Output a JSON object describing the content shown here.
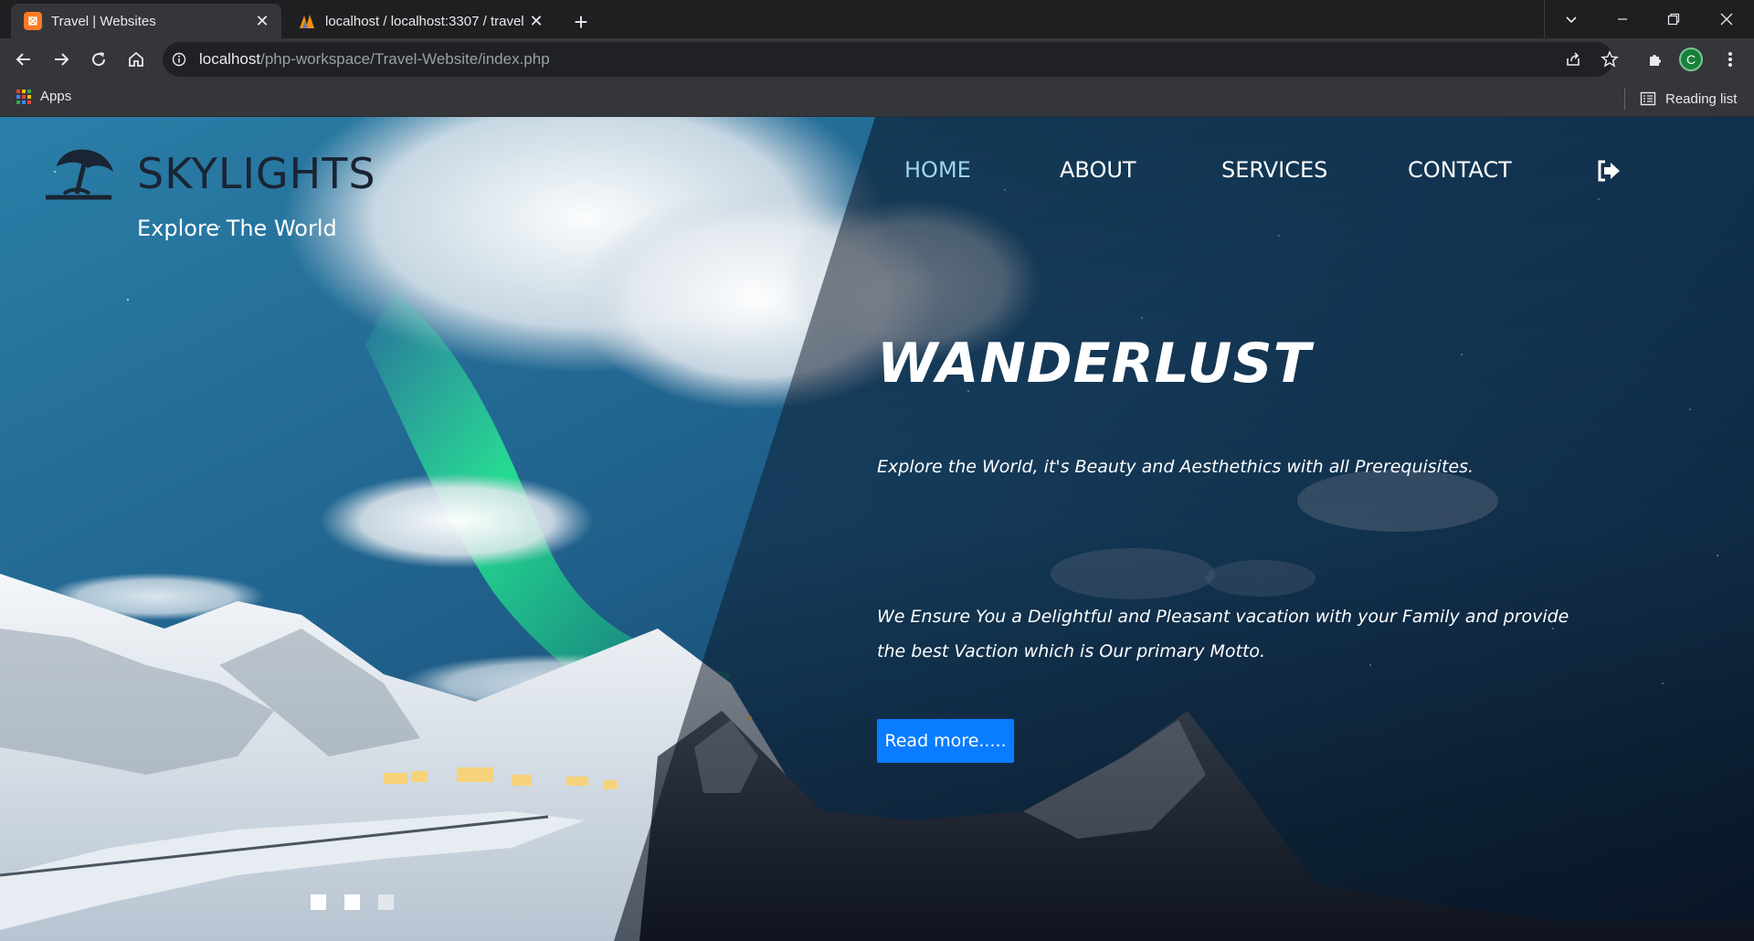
{
  "browser": {
    "tabs": [
      {
        "title": "Travel | Websites",
        "active": true,
        "favicon": "xampp-icon"
      },
      {
        "title": "localhost / localhost:3307 / travel",
        "active": false,
        "favicon": "phpmyadmin-icon"
      }
    ],
    "url_host": "localhost",
    "url_path": "/php-workspace/Travel-Website/index.php",
    "profile_initial": "C",
    "bookmarks": {
      "apps_label": "Apps",
      "reading_list_label": "Reading list"
    }
  },
  "site": {
    "logo_text": "SKYLIGHTS",
    "tagline": "Explore The World",
    "nav": [
      {
        "label": "HOME",
        "active": true
      },
      {
        "label": "ABOUT",
        "active": false
      },
      {
        "label": "SERVICES",
        "active": false
      },
      {
        "label": "CONTACT",
        "active": false
      }
    ],
    "hero": {
      "title": "WANDERLUST",
      "subtitle": "Explore the World, it's Beauty and Aesthethics with all Prerequisites.",
      "paragraph": "We Ensure You a Delightful and Pleasant vacation with your Family and provide the best Vaction which is Our primary Motto.",
      "button_label": "Read more....."
    },
    "slider_dots": [
      {
        "active": true
      },
      {
        "active": true
      },
      {
        "active": false
      }
    ]
  },
  "colors": {
    "accent_button": "#0a7cff",
    "nav_active": "#9fd4ee",
    "logo_dark": "#1a2433"
  }
}
